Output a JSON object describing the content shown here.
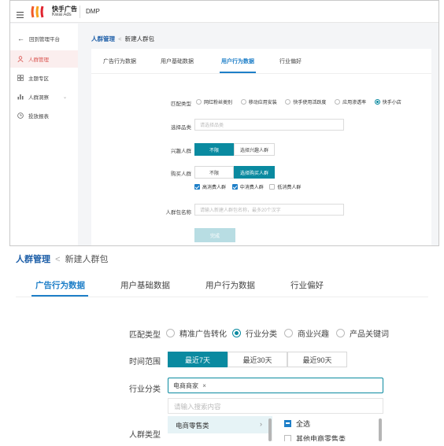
{
  "colors": {
    "accent": "#0a8aa0",
    "active_tab": "#1e7fc8",
    "sidebar_active": "#d9534f"
  },
  "shot1": {
    "brand": {
      "name_cn": "快手广告",
      "name_en": "Kwai Ads",
      "product": "DMP"
    },
    "sidebar": {
      "back": "回到管理平台",
      "items": [
        {
          "label": "人群管理",
          "icon": "users-icon",
          "active": true
        },
        {
          "label": "主题专区",
          "icon": "grid-icon"
        },
        {
          "label": "人群洞察",
          "icon": "bar-chart-icon",
          "has_arrow": true
        },
        {
          "label": "投放报表",
          "icon": "report-icon"
        }
      ]
    },
    "breadcrumb": {
      "root": "人群管理",
      "sep": "<",
      "current": "新建人群包"
    },
    "tabs": [
      "广告行为数据",
      "用户基础数据",
      "用户行为数据",
      "行业偏好"
    ],
    "active_tab_index": 2,
    "match_type": {
      "label": "匹配类型",
      "options": [
        "网红粉丝类别",
        "移动应用安装",
        "快手使用活跃度",
        "应用渗透率",
        "快手小店"
      ],
      "selected_index": 4
    },
    "category": {
      "label": "选择品类",
      "placeholder": "请选择品类"
    },
    "interest": {
      "label": "兴趣人群",
      "options": [
        "不限",
        "选择兴趣人群"
      ],
      "selected_index": 0
    },
    "purchase": {
      "label": "购买人群",
      "options": [
        "不限",
        "选择购买人群"
      ],
      "selected_index": 1,
      "checks": [
        {
          "label": "高消费人群",
          "checked": true
        },
        {
          "label": "中消费人群",
          "checked": true
        },
        {
          "label": "低消费人群",
          "checked": false
        }
      ]
    },
    "package_name": {
      "label": "人群包名称",
      "placeholder": "请输入新建人群包名称，最多20个汉字"
    },
    "submit": "完成"
  },
  "shot2": {
    "breadcrumb": {
      "root": "人群管理",
      "sep": "<",
      "current": "新建人群包"
    },
    "tabs": [
      "广告行为数据",
      "用户基础数据",
      "用户行为数据",
      "行业偏好"
    ],
    "active_tab_index": 0,
    "match_type": {
      "label": "匹配类型",
      "options": [
        "精准广告转化",
        "行业分类",
        "商业兴趣",
        "产品关键词"
      ],
      "selected_index": 1
    },
    "time_range": {
      "label": "时间范围",
      "options": [
        "最近7天",
        "最近30天",
        "最近90天"
      ],
      "selected_index": 0
    },
    "industry": {
      "label": "行业分类",
      "tag": "电商商家",
      "tag_close": "×"
    },
    "search": {
      "placeholder": "请输入搜索内容"
    },
    "dropdown": {
      "left_item": "电商零售类",
      "right_items": [
        {
          "label": "全选",
          "checked": true
        },
        {
          "label": "其他电商零售类",
          "checked": false
        }
      ]
    },
    "crowd_type": {
      "label": "人群类型"
    }
  }
}
